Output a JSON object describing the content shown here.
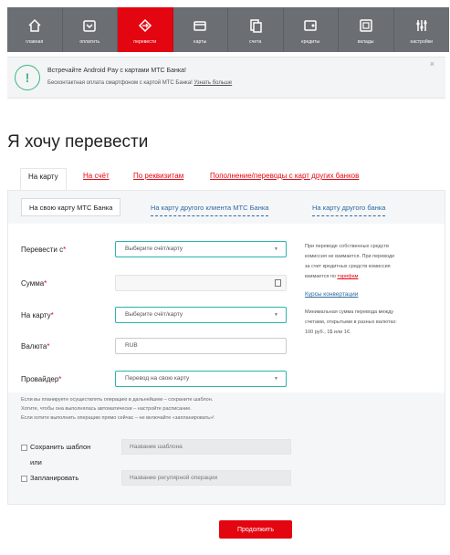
{
  "nav": {
    "items": [
      {
        "label": "главная",
        "icon": "home-icon"
      },
      {
        "label": "оплатить",
        "icon": "pay-icon"
      },
      {
        "label": "перевести",
        "icon": "transfer-icon",
        "active": true
      },
      {
        "label": "карты",
        "icon": "cards-icon"
      },
      {
        "label": "счета",
        "icon": "accounts-icon"
      },
      {
        "label": "кредиты",
        "icon": "credits-icon"
      },
      {
        "label": "вклады",
        "icon": "deposits-icon"
      },
      {
        "label": "настройки",
        "icon": "settings-icon"
      }
    ],
    "bg_color": "#6b6e72",
    "active_color": "#e30611"
  },
  "banner": {
    "title": "Встречайте Android Pay с картами МТС Банка!",
    "text": "Бесконтактная оплата смартфоном с картой МТС Банка!",
    "link": "Узнать больше",
    "close": "×",
    "icon": "exclamation-icon",
    "icon_glyph": "!"
  },
  "page": {
    "title": "Я хочу перевести"
  },
  "tabs": [
    {
      "label": "На карту",
      "active": true
    },
    {
      "label": "На счёт"
    },
    {
      "label": "По реквизитам"
    },
    {
      "label": "Пополнение/переводы с карт других банков"
    }
  ],
  "subtabs": [
    {
      "label": "На свою карту МТС Банка",
      "active": true
    },
    {
      "label": "На карту другого клиента МТС Банка"
    },
    {
      "label": "На карту другого банка"
    }
  ],
  "form": {
    "from_label": "Перевести с",
    "from_value": "Выберите счёт/карту",
    "amount_label": "Сумма",
    "amount_value": "",
    "to_card_label": "На карту",
    "to_card_value": "Выберите счёт/карту",
    "currency_label": "Валюта",
    "currency_value": "RUB",
    "provider_label": "Провайдер",
    "provider_value": "Перевод на свою карту",
    "required_mark": "*"
  },
  "side": {
    "note1_line1": "При переводе собственных средств",
    "note1_line2": "комиссия не взимается. При переводе",
    "note1_line3": "за счет кредитных средств комиссия",
    "note1_line4": "взимается по",
    "tariff_link": "тарифам",
    "rates_link": "Курсы конвертации",
    "note2_line1": "Минимальная сумма перевода между",
    "note2_line2": "счетами, открытыми в разных валютах: ",
    "note2_line3": "100 руб., 1$ или 1€."
  },
  "hint": {
    "line1": "Если вы планируете осуществлять операцию в дальнейшем – сохраните шаблон.",
    "line2": "Хотите, чтобы она выполнялась автоматически – настройте расписание.",
    "line3": "Если хотите выполнить операцию прямо сейчас – не включайте «запланировать»!"
  },
  "template": {
    "save_label": "Сохранить шаблон",
    "or_label": "или",
    "schedule_label": "Запланировать",
    "template_placeholder": "Название шаблона",
    "regular_placeholder": "Название регулярной операции"
  },
  "actions": {
    "continue_label": "Продолжить"
  }
}
